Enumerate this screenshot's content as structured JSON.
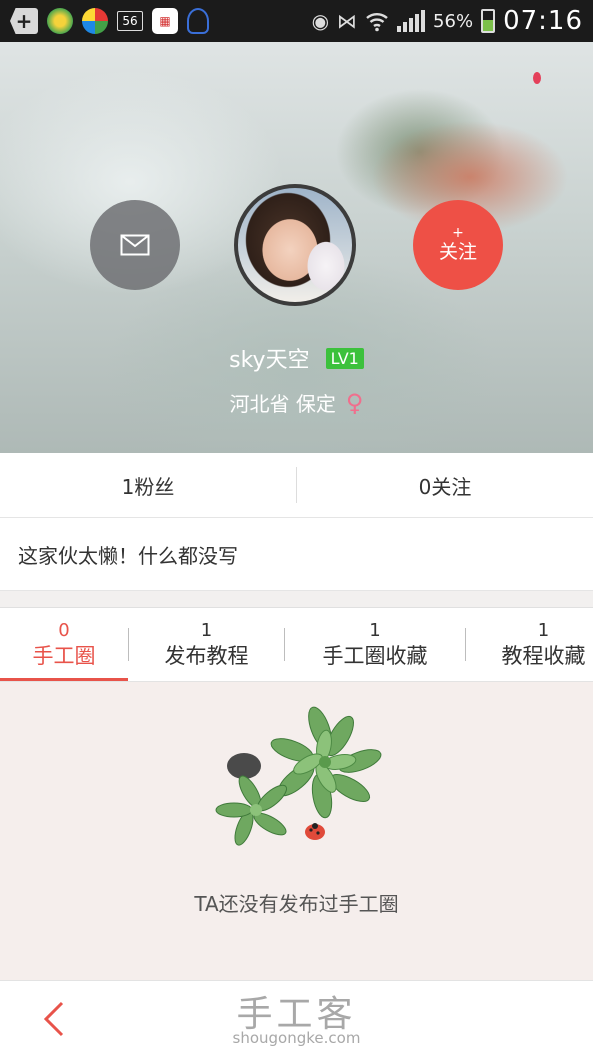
{
  "status_bar": {
    "icons": [
      "back-plus-icon",
      "app-green-icon",
      "app-color-icon",
      "notification-56-icon",
      "app-calendar-icon",
      "headset-chat-icon",
      "eye-icon",
      "nfc-icon",
      "wifi-icon",
      "signal-icon",
      "battery-icon"
    ],
    "notif_count": "56",
    "battery_percent": "56%",
    "battery_level": 0.56,
    "time": "07:16"
  },
  "profile": {
    "username": "sky天空",
    "level": "LV1",
    "location": "河北省 保定",
    "gender_symbol": "♀",
    "follow_plus": "+",
    "follow_label": "关注"
  },
  "stats": {
    "fans": "1粉丝",
    "following": "0关注"
  },
  "bio": "这家伙太懒！什么都没写",
  "tabs": [
    {
      "count": "0",
      "label": "手工圈",
      "active": true
    },
    {
      "count": "1",
      "label": "发布教程",
      "active": false
    },
    {
      "count": "1",
      "label": "手工圈收藏",
      "active": false
    },
    {
      "count": "1",
      "label": "教程收藏",
      "active": false
    }
  ],
  "empty_state": {
    "message": "TA还没有发布过手工圈"
  },
  "watermark": {
    "brand": "手工客",
    "url": "shougongke.com"
  },
  "colors": {
    "accent": "#e8534a",
    "level_green": "#3cc13c",
    "gender_pink": "#f06f8d",
    "empty_bg": "#f5eeec"
  }
}
